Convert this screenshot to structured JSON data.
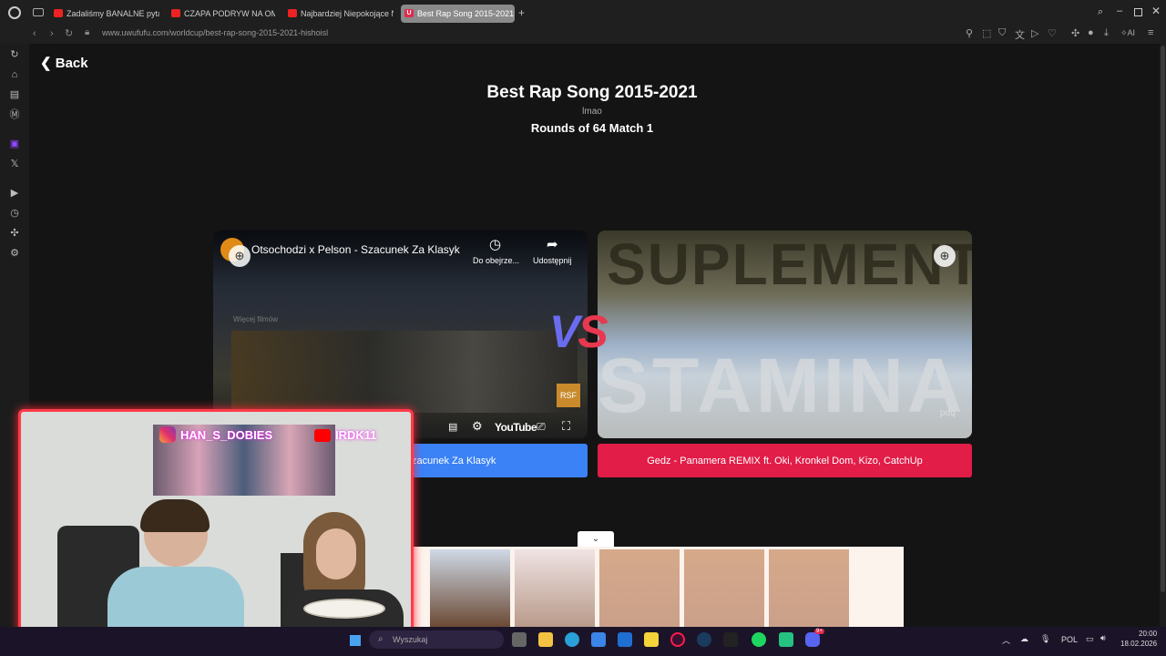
{
  "browser": {
    "tabs": [
      {
        "label": "Zadaliśmy BANALNE pytan",
        "active": false
      },
      {
        "label": "CZAPA PODRYW NA OME",
        "active": false
      },
      {
        "label": "Najbardziej Niepokojące N",
        "active": false
      },
      {
        "label": "Best Rap Song 2015-2021",
        "active": true
      }
    ],
    "url": "www.uwufufu.com/worldcup/best-rap-song-2015-2021-hishoisl",
    "active_tab_icon": "U"
  },
  "page": {
    "back_label": "Back",
    "title": "Best Rap Song 2015-2021",
    "subtitle": "lmao",
    "round": "Rounds of 64 Match 1",
    "vs": "VS",
    "left": {
      "video_title": "Otsochodzi x Pelson - Szacunek Za Klasyk",
      "watch_later": "Do obejrze...",
      "share": "Udostępnij",
      "more_videos": "Więcej filmów",
      "youtube": "YouTube",
      "choice_label": "Otsochodzi x Pelson - Szacunek Za Klasyk"
    },
    "right": {
      "image_text_top": "SUPLEMENT",
      "image_text_bottom": "STAMINA",
      "choice_label": "Gedz - Panamera REMIX ft. Oki, Kronkel Dom, Kizo, CatchUp"
    }
  },
  "overlay": {
    "instagram": "HAN_S_DOBIES",
    "youtube": "IRDK11"
  },
  "taskbar": {
    "search_placeholder": "Wyszukaj",
    "language": "POL",
    "time": "20:00",
    "date": "18.02.2026",
    "discord_badge": "9+"
  },
  "colors": {
    "left_choice": "#3b82f6",
    "right_choice": "#e11d48",
    "vs_left": "#6a6cf0",
    "vs_right": "#e8384f",
    "cam_border": "#ff3b4a"
  }
}
